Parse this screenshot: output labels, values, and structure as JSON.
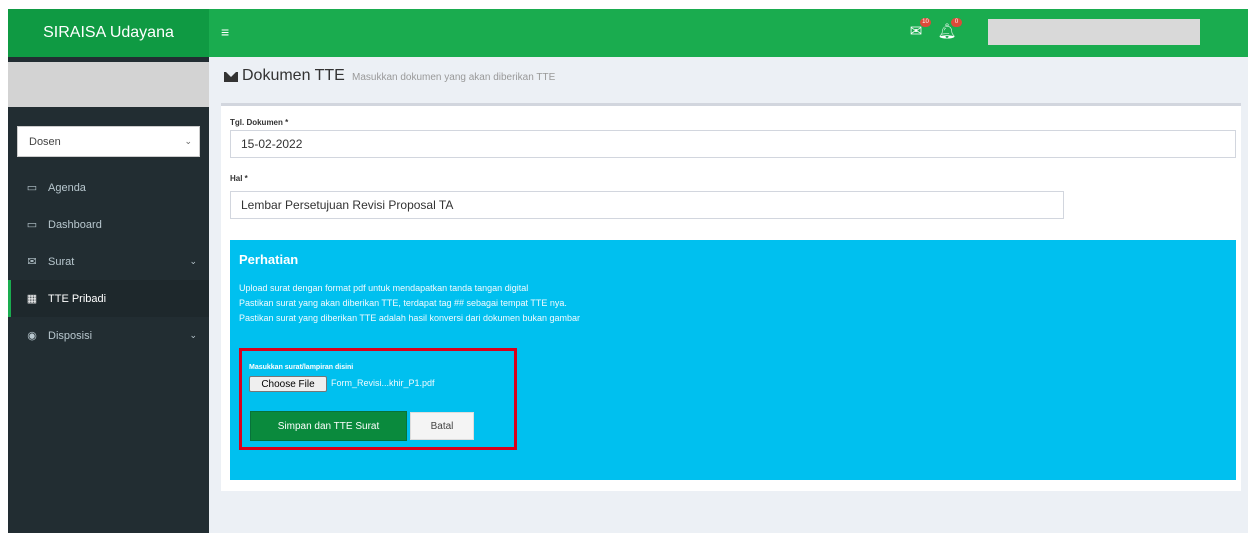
{
  "app": {
    "brand": "SIRAISA Udayana"
  },
  "topbar": {
    "menu_icon": "hamburger-icon",
    "mail_badge": "10",
    "bell_badge": "0"
  },
  "sidebar": {
    "role_select": {
      "value": "Dosen"
    },
    "items": [
      {
        "label": "Agenda",
        "icon": "calendar-icon",
        "has_chevron": false
      },
      {
        "label": "Dashboard",
        "icon": "desktop-icon",
        "has_chevron": false
      },
      {
        "label": "Surat",
        "icon": "envelope-icon",
        "has_chevron": true
      },
      {
        "label": "TTE Pribadi",
        "icon": "calendar-icon",
        "has_chevron": false,
        "active": true
      },
      {
        "label": "Disposisi",
        "icon": "eye-icon",
        "has_chevron": true
      }
    ]
  },
  "header": {
    "title": "Dokumen TTE",
    "subtitle": "Masukkan dokumen yang akan diberikan TTE"
  },
  "form": {
    "date_label": "Tgl. Dokumen *",
    "date_value": "15-02-2022",
    "subject_label": "Hal *",
    "subject_value": "Lembar Persetujuan Revisi Proposal TA"
  },
  "notice": {
    "title": "Perhatian",
    "lines": [
      "Upload surat dengan format pdf untuk mendapatkan tanda tangan digital",
      "Pastikan surat yang akan diberikan TTE, terdapat tag ## sebagai tempat TTE nya.",
      "Pastikan surat yang diberikan TTE adalah hasil konversi dari dokumen bukan gambar"
    ]
  },
  "upload": {
    "label": "Masukkan surat/lampiran disini",
    "choose_label": "Choose File",
    "file_name": "Form_Revisi...khir_P1.pdf"
  },
  "actions": {
    "save_label": "Simpan dan TTE Surat",
    "cancel_label": "Batal"
  },
  "colors": {
    "brand_dark": "#0f9a43",
    "brand": "#1aac4f",
    "sidebar_bg": "#222d32",
    "callout_bg": "#00c0ef",
    "highlight": "#d9001b",
    "save_button": "#0a8a3d"
  }
}
